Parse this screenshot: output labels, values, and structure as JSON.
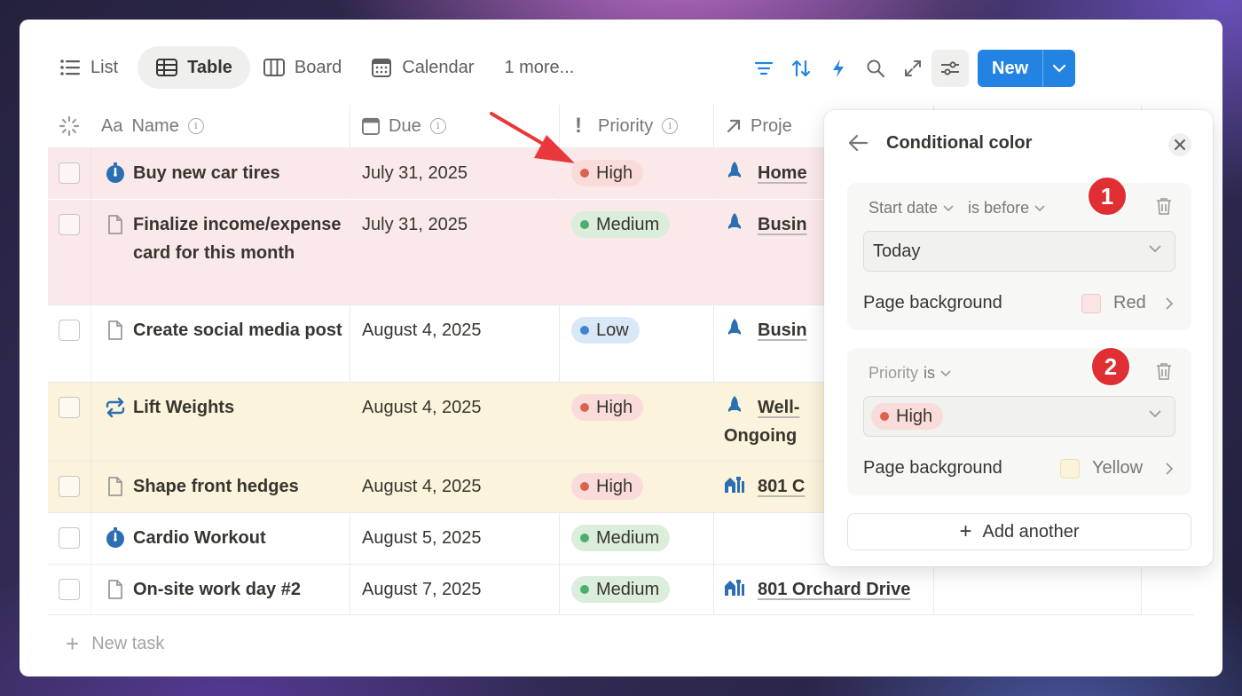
{
  "views": {
    "tabs": [
      {
        "label": "List"
      },
      {
        "label": "Table"
      },
      {
        "label": "Board"
      },
      {
        "label": "Calendar"
      },
      {
        "label": "1 more..."
      }
    ]
  },
  "toolbar": {
    "new_label": "New",
    "icons": [
      "filter-icon",
      "sort-icon",
      "lightning-icon",
      "search-icon",
      "expand-icon",
      "settings-sliders-icon"
    ]
  },
  "columns": {
    "name": "Name",
    "due": "Due",
    "priority": "Priority",
    "project": "Proje"
  },
  "rows": [
    {
      "name": "Buy new car tires",
      "due": "July 31, 2025",
      "priority": "High",
      "project": "Home",
      "background": "#fbe9e9"
    },
    {
      "name": "Finalize income/expense card for this month",
      "due": "July 31, 2025",
      "priority": "Medium",
      "project": "Busin",
      "background": "#fbe9e9"
    },
    {
      "name": "Create social media post",
      "due": "August 4, 2025",
      "priority": "Low",
      "project": "Busin",
      "background": "#ffffff"
    },
    {
      "name": "Lift Weights",
      "due": "August 4, 2025",
      "priority": "High",
      "project": "Well-",
      "project_line2": "Ongoing",
      "background": "#fbf3db"
    },
    {
      "name": "Shape front hedges",
      "due": "August 4, 2025",
      "priority": "High",
      "project": "801 C",
      "background": "#fbf3db"
    },
    {
      "name": "Cardio Workout",
      "due": "August 5, 2025",
      "priority": "Medium",
      "project": "",
      "background": "#ffffff"
    },
    {
      "name": "On-site work day #2",
      "due": "August 7, 2025",
      "priority": "Medium",
      "project": "801 Orchard Drive",
      "background": "#ffffff"
    }
  ],
  "new_task_label": "New task",
  "panel": {
    "title": "Conditional color",
    "rules": [
      {
        "number": "1",
        "property": "Start date",
        "operator": "is before",
        "value": "Today",
        "bg_label": "Page background",
        "bg_value": "Red",
        "bg_color": "#fbe4e4"
      },
      {
        "number": "2",
        "property": "Priority",
        "operator": "is",
        "value": "High",
        "bg_label": "Page background",
        "bg_value": "Yellow",
        "bg_color": "#fbf3db"
      }
    ],
    "add_label": "Add another"
  },
  "colors": {
    "accent": "#2383e2",
    "badge": "#df2f32",
    "arrow": "#e8383b",
    "high": "#f9dcd9",
    "medium": "#dbeddb",
    "low": "#d9e8f6"
  }
}
